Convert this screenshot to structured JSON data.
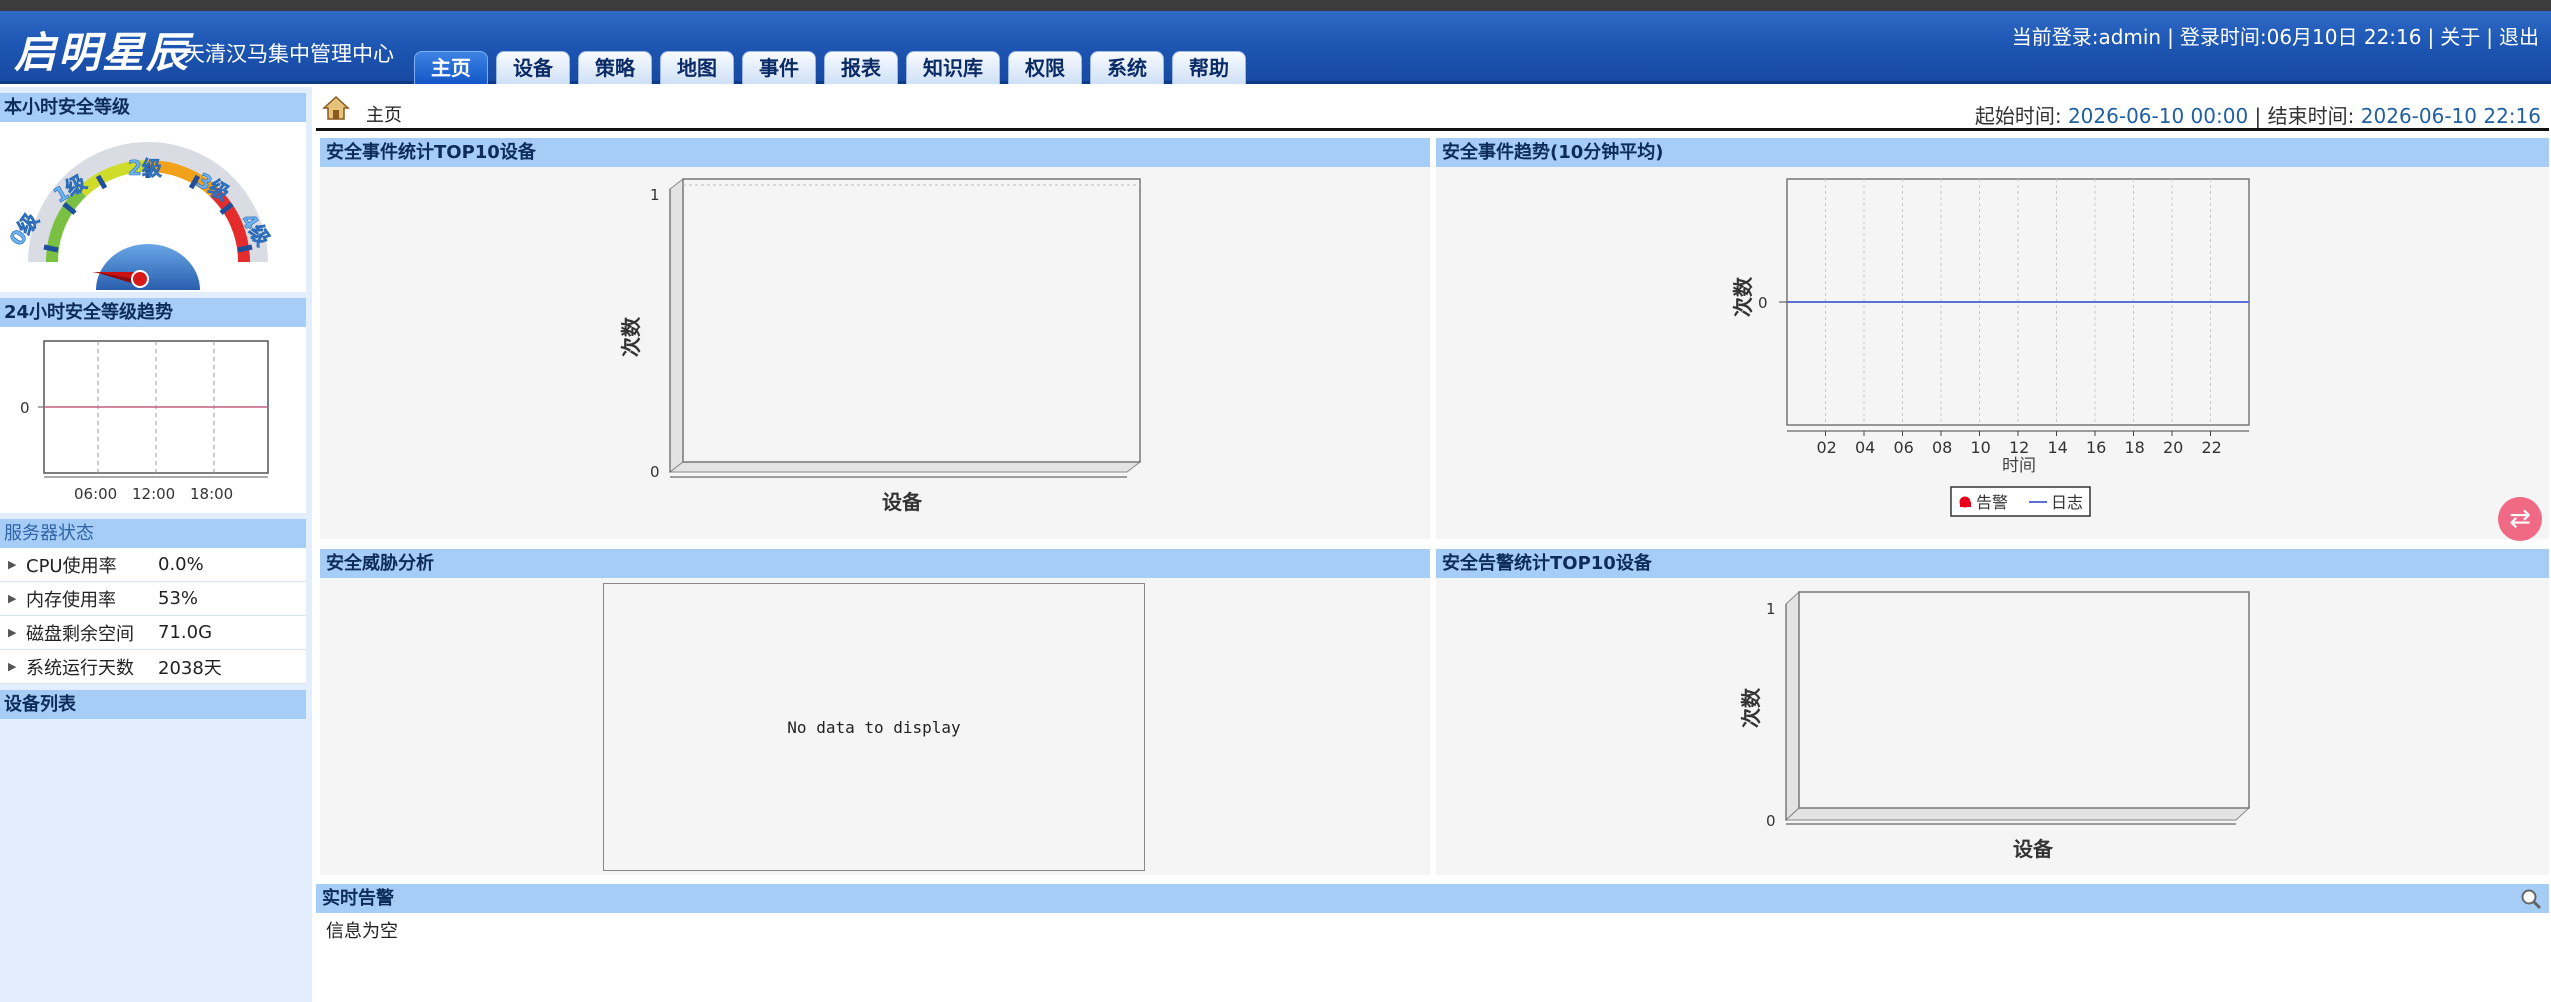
{
  "header": {
    "logo": "启明星辰",
    "subtitle": "天清汉马集中管理中心",
    "user": "当前登录:admin",
    "login_time": "登录时间:06月10日 22:16",
    "about": "关于",
    "logout": "退出"
  },
  "nav": {
    "tabs": [
      "主页",
      "设备",
      "策略",
      "地图",
      "事件",
      "报表",
      "知识库",
      "权限",
      "系统",
      "帮助"
    ],
    "active": "主页"
  },
  "sidebar": {
    "hour_level_title": "本小时安全等级",
    "gauge_labels": [
      "0级",
      "1级",
      "2级",
      "3级",
      "4级"
    ],
    "trend_title": "24小时安全等级趋势",
    "trend_y": "0",
    "trend_x": [
      "06:00",
      "12:00",
      "18:00"
    ],
    "server_status_title": "服务器状态",
    "stats": [
      {
        "label": "CPU使用率",
        "value": "0.0%"
      },
      {
        "label": "内存使用率",
        "value": "53%"
      },
      {
        "label": "磁盘剩余空间",
        "value": "71.0G"
      },
      {
        "label": "系统运行天数",
        "value": "2038天"
      }
    ],
    "device_list_title": "设备列表"
  },
  "breadcrumb": {
    "home": "主页",
    "start_label": "起始时间:",
    "start_value": "2026-06-10 00:00",
    "end_label": "结束时间:",
    "end_value": "2026-06-10 22:16"
  },
  "panels": {
    "top10_events": {
      "title": "安全事件统计TOP10设备",
      "ylabel": "次数",
      "xlabel": "设备",
      "y_ticks": [
        "1",
        "0"
      ]
    },
    "event_trend": {
      "title": "安全事件趋势(10分钟平均)",
      "ylabel": "次数",
      "xlabel": "时间",
      "y_ticks": [
        "0"
      ],
      "x_ticks": [
        "02",
        "04",
        "06",
        "08",
        "10",
        "12",
        "14",
        "16",
        "18",
        "20",
        "22"
      ],
      "legend": [
        "告警",
        "日志"
      ]
    },
    "threat": {
      "title": "安全威胁分析",
      "empty": "No data to display"
    },
    "top10_alerts": {
      "title": "安全告警统计TOP10设备",
      "ylabel": "次数",
      "xlabel": "设备",
      "y_ticks": [
        "1",
        "0"
      ]
    }
  },
  "alerts": {
    "title": "实时告警",
    "empty": "信息为空"
  },
  "colors": {
    "header": "#1e57b4",
    "section": "#a5cdf6",
    "sidebar": "#e3eefc",
    "trend_line": "#5b6fd6",
    "alarm": "#e8001c"
  }
}
